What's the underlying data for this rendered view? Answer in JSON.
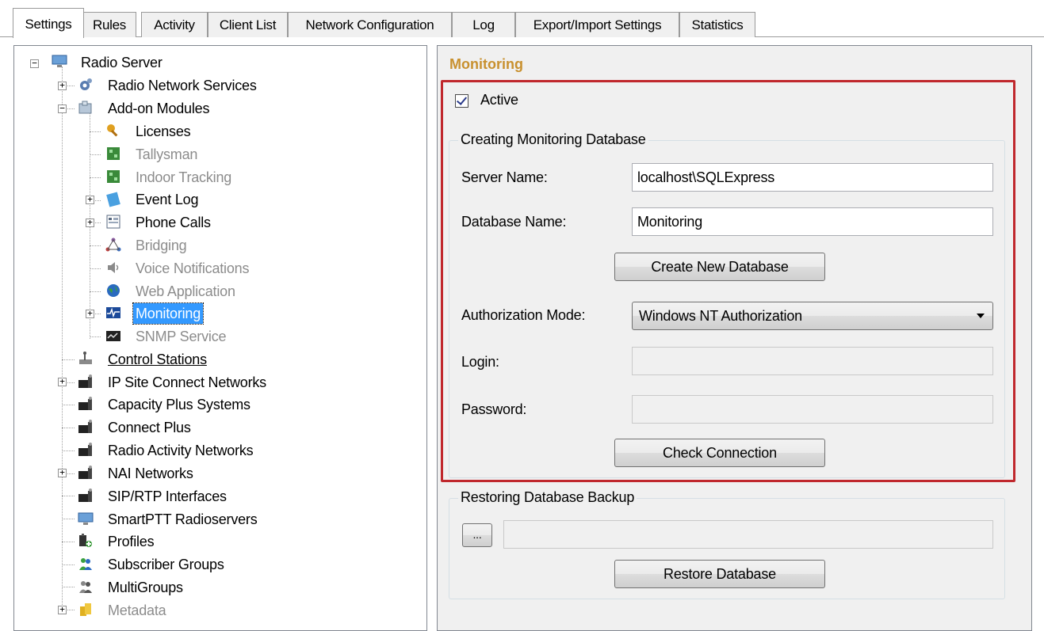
{
  "tabs": [
    "Settings",
    "Rules",
    "Activity",
    "Client List",
    "Network Configuration",
    "Log",
    "Export/Import Settings",
    "Statistics"
  ],
  "tree": {
    "root": "Radio Server",
    "radio_network_services": "Radio Network Services",
    "addon_modules": "Add-on Modules",
    "licenses": "Licenses",
    "tallysman": "Tallysman",
    "indoor_tracking": "Indoor Tracking",
    "event_log": "Event Log",
    "phone_calls": "Phone Calls",
    "bridging": "Bridging",
    "voice_notifications": "Voice Notifications",
    "web_application": "Web Application",
    "monitoring": "Monitoring",
    "snmp_service": "SNMP Service",
    "control_stations": "Control Stations",
    "ip_site_connect": "IP Site Connect Networks",
    "capacity_plus": "Capacity Plus Systems",
    "connect_plus": "Connect Plus",
    "radio_activity": "Radio Activity Networks",
    "nai_networks": "NAI Networks",
    "sip_rtp": "SIP/RTP Interfaces",
    "smartptt_radioservers": "SmartPTT Radioservers",
    "profiles": "Profiles",
    "subscriber_groups": "Subscriber Groups",
    "multigroups": "MultiGroups",
    "metadata": "Metadata"
  },
  "panel": {
    "title": "Monitoring",
    "active_label": "Active",
    "active_checked": true,
    "create_group": "Creating Monitoring Database",
    "server_name_label": "Server Name:",
    "server_name_value": "localhost\\SQLExpress",
    "database_name_label": "Database Name:",
    "database_name_value": "Monitoring",
    "create_button": "Create New Database",
    "auth_mode_label": "Authorization Mode:",
    "auth_mode_value": "Windows NT Authorization",
    "login_label": "Login:",
    "login_value": "",
    "password_label": "Password:",
    "password_value": "",
    "check_button": "Check Connection",
    "restore_group": "Restoring Database Backup",
    "browse_button": "...",
    "backup_path": "",
    "restore_button": "Restore Database"
  },
  "colors": {
    "title": "#c8902e",
    "highlight_border": "#c0282d",
    "selection": "#3399ff"
  }
}
